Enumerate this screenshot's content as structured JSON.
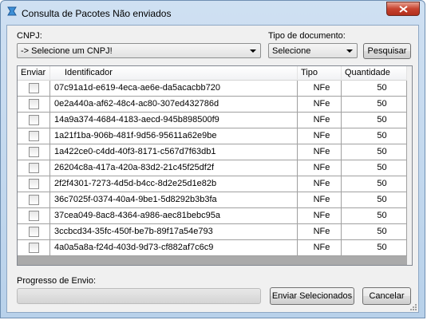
{
  "window": {
    "title": "Consulta de Pacotes Não enviados"
  },
  "filters": {
    "cnpj_label": "CNPJ:",
    "cnpj_value": "-> Selecione um CNPJ!",
    "tipo_label": "Tipo de documento:",
    "tipo_value": "Selecione",
    "search_button": "Pesquisar"
  },
  "table": {
    "columns": [
      "Enviar",
      "Identificador",
      "Tipo",
      "Quantidade"
    ],
    "rows": [
      {
        "id": "07c91a1d-e619-4eca-ae6e-da5acacbb720",
        "tipo": "NFe",
        "qtd": "50"
      },
      {
        "id": "0e2a440a-af62-48c4-ac80-307ed432786d",
        "tipo": "NFe",
        "qtd": "50"
      },
      {
        "id": "14a9a374-4684-4183-aecd-945b898500f9",
        "tipo": "NFe",
        "qtd": "50"
      },
      {
        "id": "1a21f1ba-906b-481f-9d56-95611a62e9be",
        "tipo": "NFe",
        "qtd": "50"
      },
      {
        "id": "1a422ce0-c4dd-40f3-8171-c567d7f63db1",
        "tipo": "NFe",
        "qtd": "50"
      },
      {
        "id": "26204c8a-417a-420a-83d2-21c45f25df2f",
        "tipo": "NFe",
        "qtd": "50"
      },
      {
        "id": "2f2f4301-7273-4d5d-b4cc-8d2e25d1e82b",
        "tipo": "NFe",
        "qtd": "50"
      },
      {
        "id": "36c7025f-0374-40a4-9be1-5d8292b3b3fa",
        "tipo": "NFe",
        "qtd": "50"
      },
      {
        "id": "37cea049-8ac8-4364-a986-aec81bebc95a",
        "tipo": "NFe",
        "qtd": "50"
      },
      {
        "id": "3ccbcd34-35fc-450f-be7b-89f17a54e793",
        "tipo": "NFe",
        "qtd": "50"
      },
      {
        "id": "4a0a5a8a-f24d-403d-9d73-cf882af7c6c9",
        "tipo": "NFe",
        "qtd": "50"
      }
    ]
  },
  "footer": {
    "progress_label": "Progresso de Envio:",
    "progress_value": 0,
    "send_button": "Enviar Selecionados",
    "cancel_button": "Cancelar"
  },
  "icons": {
    "app": "app-icon",
    "close": "close-icon"
  },
  "colors": {
    "title_bar": "#cfe0f2",
    "close_button": "#c7432f",
    "progress_fill": "#06b025"
  }
}
